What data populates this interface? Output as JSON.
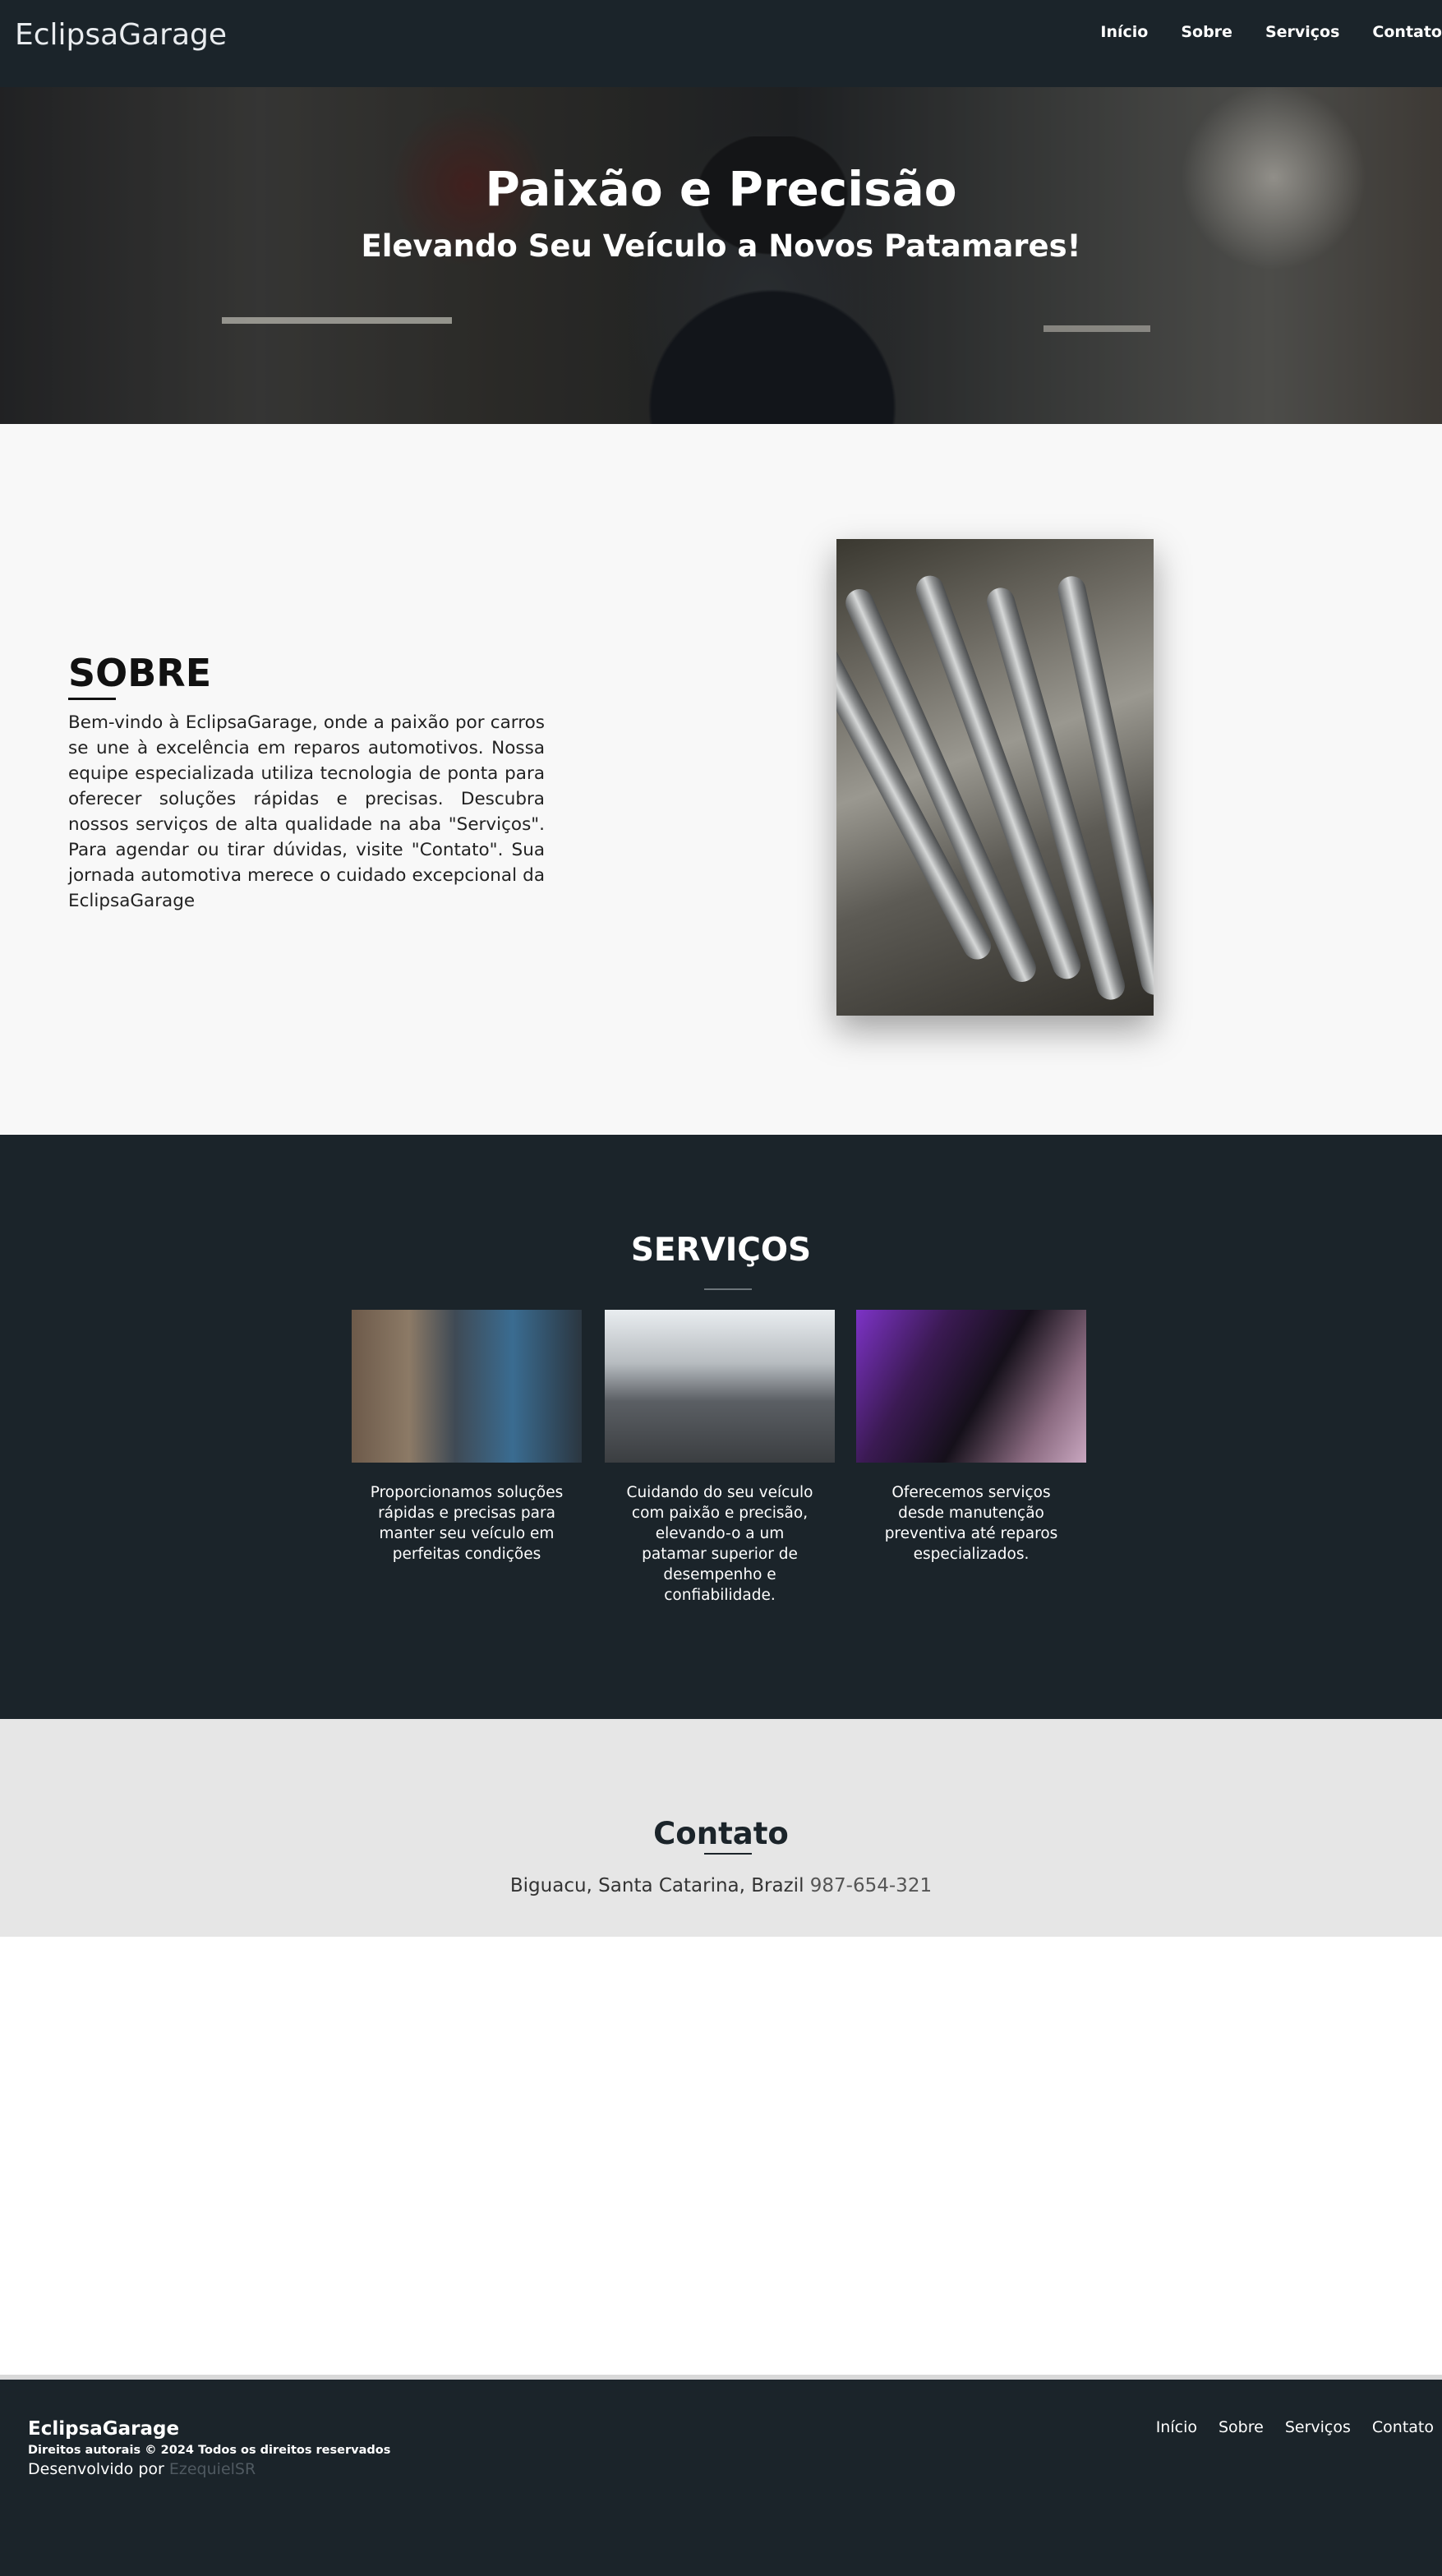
{
  "header": {
    "brand": "EclipsaGarage",
    "nav": [
      "Início",
      "Sobre",
      "Serviços",
      "Contato"
    ]
  },
  "hero": {
    "title": "Paixão e Precisão",
    "subtitle": "Elevando Seu Veículo a Novos Patamares!"
  },
  "about": {
    "title": "SOBRE",
    "text": "Bem-vindo à EclipsaGarage, onde a paixão por carros se une à excelência em reparos automotivos. Nossa equipe especializada utiliza tecnologia de ponta para oferecer soluções rápidas e precisas. Descubra nossos serviços de alta qualidade na aba \"Serviços\". Para agendar ou tirar dúvidas, visite \"Contato\". Sua jornada automotiva merece o cuidado excepcional da EclipsaGarage"
  },
  "services": {
    "title": "SERVIÇOS",
    "items": [
      {
        "text": "Proporcionamos soluções rápidas e precisas para manter seu veículo em perfeitas condições"
      },
      {
        "text": "Cuidando do seu veículo com paixão e precisão, elevando-o a um patamar superior de desempenho e confiabilidade."
      },
      {
        "text": "Oferecemos serviços desde manutenção preventiva até reparos especializados."
      }
    ]
  },
  "contact": {
    "title": "Contato",
    "location": "Biguacu, Santa Catarina, Brazil",
    "phone": "987-654-321"
  },
  "footer": {
    "brand": "EclipsaGarage",
    "copyright": "Direitos autorais © 2024 Todos os direitos reservados",
    "developed_by": "Desenvolvido por",
    "developer": "EzequielSR",
    "nav": [
      "Início",
      "Sobre",
      "Serviços",
      "Contato"
    ]
  },
  "colors": {
    "header_bg": "#1b242a",
    "about_bg": "#f8f8f8",
    "contact_bg": "#e6e6e6"
  }
}
